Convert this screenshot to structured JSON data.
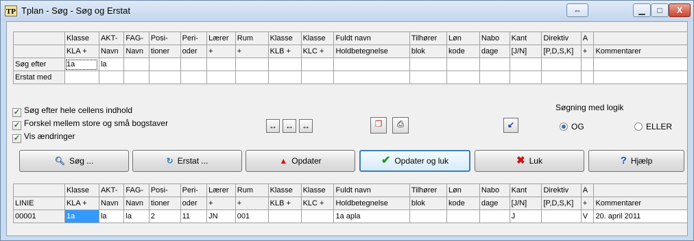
{
  "window": {
    "icon_text": "TP",
    "title": "Tplan - Søg - Søg og Erstat",
    "restore_glyph": "⇔",
    "minimize_glyph": "▁",
    "maximize_glyph": "□",
    "close_glyph": "X"
  },
  "search_grid": {
    "header_row1": [
      "",
      "Klasse",
      "AKT-",
      "FAG-",
      "Posi-",
      "Peri-",
      "Lærer",
      "Rum",
      "Klasse",
      "Klasse",
      "Fuldt navn",
      "Tilhører",
      "Løn",
      "Nabo",
      "Kant",
      "Direktiv",
      "A",
      ""
    ],
    "header_row2": [
      "",
      "KLA +",
      "Navn",
      "Navn",
      "tioner",
      "oder",
      "+",
      "+",
      "KLB +",
      "KLC +",
      "Holdbetegnelse",
      "blok",
      "kode",
      "dage",
      "[J/N]",
      "[P,D,S,K]",
      "+",
      "Kommentarer"
    ],
    "search_label": "Søg efter",
    "search_values": [
      "1a",
      "la",
      "",
      "",
      "",
      "",
      "",
      "",
      "",
      "",
      "",
      "",
      "",
      "",
      "",
      "",
      ""
    ],
    "replace_label": "Erstat med",
    "replace_values": [
      "",
      "",
      "",
      "",
      "",
      "",
      "",
      "",
      "",
      "",
      "",
      "",
      "",
      "",
      "",
      "",
      ""
    ]
  },
  "options": {
    "whole_cell": "Søg efter hele cellens indhold",
    "case_sensitive": "Forskel mellem store og små bogstaver",
    "show_changes": "Vis ændringer",
    "checked": [
      true,
      true,
      true
    ]
  },
  "logic": {
    "label": "Søgning med logik",
    "og": "OG",
    "eller": "ELLER",
    "selected": "OG"
  },
  "buttons": {
    "search": "Søg ...",
    "replace": "Erstat ...",
    "update": "Opdater",
    "update_close": "Opdater og luk",
    "close": "Luk",
    "help": "Hjælp"
  },
  "results_grid": {
    "header_row1": [
      "",
      "Klasse",
      "AKT-",
      "FAG-",
      "Posi-",
      "Peri-",
      "Lærer",
      "Rum",
      "Klasse",
      "Klasse",
      "Fuldt navn",
      "Tilhører",
      "Løn",
      "Nabo",
      "Kant",
      "Direktiv",
      "A",
      ""
    ],
    "header_row2": [
      "LINIE",
      "KLA +",
      "Navn",
      "Navn",
      "tioner",
      "oder",
      "+",
      "+",
      "KLB +",
      "KLC +",
      "Holdbetegnelse",
      "blok",
      "kode",
      "dage",
      "[J/N]",
      "[P,D,S,K]",
      "+",
      "Kommentarer"
    ],
    "rows": [
      [
        "00001",
        "1a",
        "la",
        "la",
        "2",
        "11",
        "JN",
        "001",
        "",
        "",
        "1a apla",
        "",
        "",
        "",
        "J",
        "",
        "V",
        "20. april 2011"
      ]
    ]
  },
  "colors": {
    "selection": "#3399ff",
    "title_bg": "#c4d6ec",
    "close_btn": "#c7452d"
  }
}
